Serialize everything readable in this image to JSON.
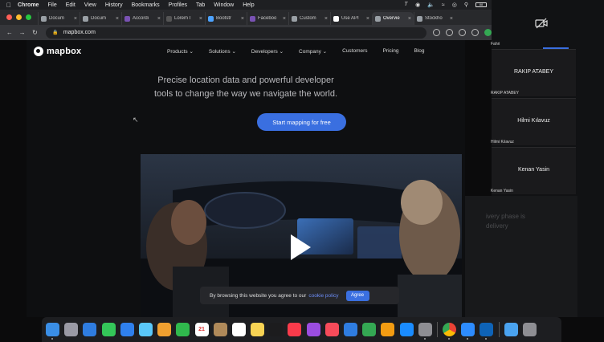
{
  "menubar": {
    "app": "Chrome",
    "items": [
      "File",
      "Edit",
      "View",
      "History",
      "Bookmarks",
      "Profiles",
      "Tab",
      "Window",
      "Help"
    ],
    "battery": "88"
  },
  "tabs": [
    {
      "label": "Docum",
      "favicon_color": "#9aa0a6"
    },
    {
      "label": "Docum",
      "favicon_color": "#9aa0a6"
    },
    {
      "label": "Accordi",
      "favicon_color": "#7952b3"
    },
    {
      "label": "Lorem I",
      "favicon_color": "#555555"
    },
    {
      "label": "Bootstr",
      "favicon_color": "#4da3ff"
    },
    {
      "label": "Faceboo",
      "favicon_color": "#7952b3"
    },
    {
      "label": "Custom",
      "favicon_color": "#9aa0a6"
    },
    {
      "label": "Use API",
      "favicon_color": "#ffffff"
    },
    {
      "label": "Overvie",
      "favicon_color": "#9aa0a6"
    },
    {
      "label": "Stockho",
      "favicon_color": "#9aa0a6"
    }
  ],
  "url": "mapbox.com",
  "site": {
    "logo": "mapbox",
    "nav": [
      "Products ⌄",
      "Solutions ⌄",
      "Developers ⌄",
      "Company ⌄",
      "Customers",
      "Pricing",
      "Blog"
    ],
    "hero_line1": "Precise location data and powerful developer",
    "hero_line2": "tools to change the way we navigate the world.",
    "cta": "Start mapping for free",
    "cookie_text": "By browsing this website you agree to our",
    "cookie_link": "cookie policy",
    "cookie_button": "Agree"
  },
  "participants": {
    "top_small": "Fahri",
    "tiles": [
      {
        "name": "RAKIP ATABEY",
        "small": "RAKIP ATABEY"
      },
      {
        "name": "Hilmi Kılavuz",
        "small": "Hilmi Kılavuz"
      },
      {
        "name": "Kenan Yasin",
        "small": "Kenan Yasin"
      }
    ],
    "behind_text_line1": "ivery phase is",
    "behind_text_line2": "delivery"
  },
  "dock": {
    "calendar_day": "21",
    "icons": [
      "finder-icon",
      "launchpad-icon",
      "safari-icon",
      "messages-icon",
      "mail-icon",
      "maps-icon",
      "photos-icon",
      "facetime-icon",
      "calendar-icon",
      "contacts-icon",
      "reminders-icon",
      "notes-icon",
      "appletv-icon",
      "music-icon",
      "podcasts-icon",
      "news-icon",
      "keynote-icon",
      "numbers-icon",
      "pages-icon",
      "appstore-icon",
      "settings-icon",
      "chrome-icon",
      "zoom-icon",
      "vscode-icon",
      "folder-icon",
      "trash-icon"
    ],
    "colors": [
      "#3a8ee6",
      "#9a9aa5",
      "#2f7de1",
      "#34c759",
      "#2f80ed",
      "#5ac8fa",
      "#f0a030",
      "#30b94d",
      "#ffffff",
      "#b08a5a",
      "#ffffff",
      "#f7d354",
      "#1c1c1e",
      "#fa3b4b",
      "#9b4de0",
      "#f74b5a",
      "#2f7de1",
      "#34a853",
      "#f39c12",
      "#1a8cff",
      "#8e8e93",
      "#eeeeee",
      "#2d8cff",
      "#0e63b7",
      "#4aa3f0",
      "#8e8e93"
    ]
  }
}
